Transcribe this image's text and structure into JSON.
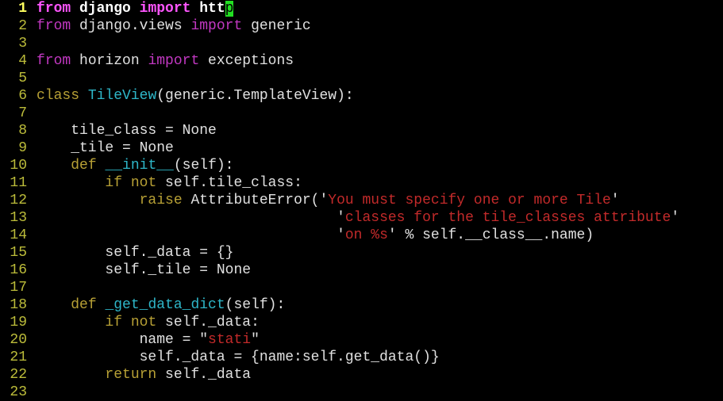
{
  "editor": {
    "colors": {
      "background": "#000000",
      "line_number": "#bcbc3a",
      "current_line_number": "#ffff5f",
      "keyword": "#c238c2",
      "definition_keyword": "#b7a035",
      "identifier": "#e0e0e0",
      "function_name": "#2eb6c8",
      "string": "#c22a2a",
      "cursor": "#22e022"
    },
    "cursor_line": 1,
    "lines": [
      {
        "n": "1",
        "current": true,
        "tokens": [
          {
            "t": "from",
            "c": "kw"
          },
          {
            "t": " django ",
            "c": "id"
          },
          {
            "t": "import",
            "c": "kw"
          },
          {
            "t": " htt",
            "c": "id"
          },
          {
            "t": "p",
            "c": "cursor"
          }
        ]
      },
      {
        "n": "2",
        "tokens": [
          {
            "t": "from",
            "c": "kw"
          },
          {
            "t": " django.views ",
            "c": "id"
          },
          {
            "t": "import",
            "c": "kw"
          },
          {
            "t": " generic",
            "c": "id"
          }
        ]
      },
      {
        "n": "3",
        "tokens": []
      },
      {
        "n": "4",
        "tokens": [
          {
            "t": "from",
            "c": "kw"
          },
          {
            "t": " horizon ",
            "c": "id"
          },
          {
            "t": "import",
            "c": "kw"
          },
          {
            "t": " exceptions",
            "c": "id"
          }
        ]
      },
      {
        "n": "5",
        "tokens": []
      },
      {
        "n": "6",
        "tokens": [
          {
            "t": "class",
            "c": "def"
          },
          {
            "t": " ",
            "c": "id"
          },
          {
            "t": "TileView",
            "c": "fn"
          },
          {
            "t": "(generic.TemplateView):",
            "c": "id"
          }
        ]
      },
      {
        "n": "7",
        "tokens": []
      },
      {
        "n": "8",
        "tokens": [
          {
            "t": "    tile_class = None",
            "c": "id"
          }
        ]
      },
      {
        "n": "9",
        "tokens": [
          {
            "t": "    _tile = None",
            "c": "id"
          }
        ]
      },
      {
        "n": "10",
        "tokens": [
          {
            "t": "    ",
            "c": "id"
          },
          {
            "t": "def",
            "c": "def"
          },
          {
            "t": " ",
            "c": "id"
          },
          {
            "t": "__init__",
            "c": "fn"
          },
          {
            "t": "(self):",
            "c": "id"
          }
        ]
      },
      {
        "n": "11",
        "tokens": [
          {
            "t": "        ",
            "c": "id"
          },
          {
            "t": "if",
            "c": "def"
          },
          {
            "t": " ",
            "c": "id"
          },
          {
            "t": "not",
            "c": "def"
          },
          {
            "t": " self.tile_class:",
            "c": "id"
          }
        ]
      },
      {
        "n": "12",
        "tokens": [
          {
            "t": "            ",
            "c": "id"
          },
          {
            "t": "raise",
            "c": "def"
          },
          {
            "t": " AttributeError(",
            "c": "id"
          },
          {
            "t": "'",
            "c": "q"
          },
          {
            "t": "You must specify one or more Tile",
            "c": "str"
          },
          {
            "t": "'",
            "c": "q"
          }
        ]
      },
      {
        "n": "13",
        "tokens": [
          {
            "t": "                                   ",
            "c": "id"
          },
          {
            "t": "'",
            "c": "q"
          },
          {
            "t": "classes for the tile_classes attribute",
            "c": "str"
          },
          {
            "t": "'",
            "c": "q"
          }
        ]
      },
      {
        "n": "14",
        "tokens": [
          {
            "t": "                                   ",
            "c": "id"
          },
          {
            "t": "'",
            "c": "q"
          },
          {
            "t": "on %s",
            "c": "str"
          },
          {
            "t": "' % self.__class__.name)",
            "c": "id"
          }
        ]
      },
      {
        "n": "15",
        "tokens": [
          {
            "t": "        self._data = {}",
            "c": "id"
          }
        ]
      },
      {
        "n": "16",
        "tokens": [
          {
            "t": "        self._tile = None",
            "c": "id"
          }
        ]
      },
      {
        "n": "17",
        "tokens": []
      },
      {
        "n": "18",
        "tokens": [
          {
            "t": "    ",
            "c": "id"
          },
          {
            "t": "def",
            "c": "def"
          },
          {
            "t": " ",
            "c": "id"
          },
          {
            "t": "_get_data_dict",
            "c": "fn"
          },
          {
            "t": "(self):",
            "c": "id"
          }
        ]
      },
      {
        "n": "19",
        "tokens": [
          {
            "t": "        ",
            "c": "id"
          },
          {
            "t": "if",
            "c": "def"
          },
          {
            "t": " ",
            "c": "id"
          },
          {
            "t": "not",
            "c": "def"
          },
          {
            "t": " self._data:",
            "c": "id"
          }
        ]
      },
      {
        "n": "20",
        "tokens": [
          {
            "t": "            name = ",
            "c": "id"
          },
          {
            "t": "\"",
            "c": "q"
          },
          {
            "t": "stati",
            "c": "str"
          },
          {
            "t": "\"",
            "c": "q"
          }
        ]
      },
      {
        "n": "21",
        "tokens": [
          {
            "t": "            self._data = {name:self.get_data()}",
            "c": "id"
          }
        ]
      },
      {
        "n": "22",
        "tokens": [
          {
            "t": "        ",
            "c": "id"
          },
          {
            "t": "return",
            "c": "def"
          },
          {
            "t": " self._data",
            "c": "id"
          }
        ]
      },
      {
        "n": "23",
        "tokens": []
      }
    ]
  }
}
